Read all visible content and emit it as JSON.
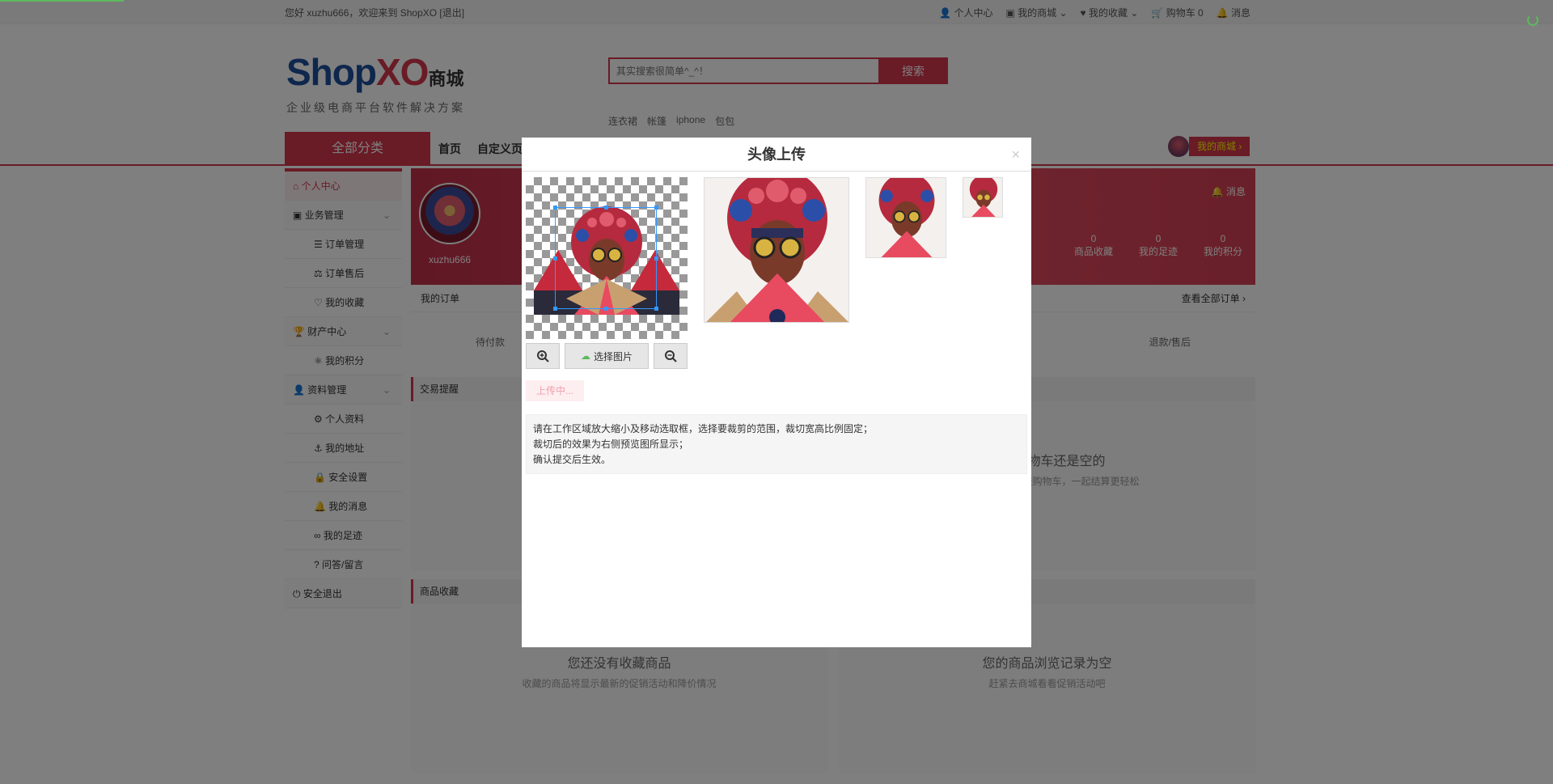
{
  "topbar": {
    "welcome_prefix": "您好 xuzhu666，欢迎来到 ShopXO",
    "logout": "[退出]",
    "nav": [
      "个人中心",
      "我的商城",
      "我的收藏",
      "购物车 0",
      "消息"
    ]
  },
  "logo": {
    "shop": "Shop",
    "xo": "XO",
    "mall": "商城",
    "slogan": "企业级电商平台软件解决方案"
  },
  "search": {
    "placeholder": "其实搜索很简单^_^！",
    "button": "搜索",
    "hotwords": [
      "连衣裙",
      "帐篷",
      "iphone",
      "包包"
    ]
  },
  "navbar": {
    "all_categories": "全部分类",
    "links": [
      "首页",
      "自定义页"
    ],
    "my_mall": "我的商城 ›"
  },
  "sidebar": {
    "items": [
      {
        "label": "个人中心",
        "type": "active"
      },
      {
        "label": "业务管理",
        "type": "group"
      },
      {
        "label": "订单管理",
        "type": "sub"
      },
      {
        "label": "订单售后",
        "type": "sub"
      },
      {
        "label": "我的收藏",
        "type": "sub"
      },
      {
        "label": "财产中心",
        "type": "group"
      },
      {
        "label": "我的积分",
        "type": "sub"
      },
      {
        "label": "资料管理",
        "type": "group"
      },
      {
        "label": "个人资料",
        "type": "sub"
      },
      {
        "label": "我的地址",
        "type": "sub"
      },
      {
        "label": "安全设置",
        "type": "sub"
      },
      {
        "label": "我的消息",
        "type": "sub"
      },
      {
        "label": "我的足迹",
        "type": "sub"
      },
      {
        "label": "问答/留言",
        "type": "sub"
      },
      {
        "label": "安全退出",
        "type": "group"
      }
    ]
  },
  "profile": {
    "username": "xuzhu666",
    "message": "消息",
    "stats": [
      {
        "value": "0",
        "label": "商品收藏"
      },
      {
        "value": "0",
        "label": "我的足迹"
      },
      {
        "value": "0",
        "label": "我的积分"
      }
    ]
  },
  "orders": {
    "title": "我的订单",
    "view_all": "查看全部订单 ›",
    "first": "待付款",
    "last": "退款/售后"
  },
  "sections": {
    "trade_alert": "交易提醒",
    "favorites": "商品收藏",
    "cart_empty": "您的购物车还是空的",
    "cart_empty_sub": "将想买的商品放进购物车，一起结算更轻松",
    "fav_empty": "您还没有收藏商品",
    "fav_empty_sub": "收藏的商品将显示最新的促销活动和降价情况",
    "history_empty": "您的商品浏览记录为空",
    "history_empty_sub": "赶紧去商城看看促销活动吧"
  },
  "modal": {
    "title": "头像上传",
    "close": "×",
    "zoom_in": "zoom-in",
    "choose": "选择图片",
    "zoom_out": "zoom-out",
    "upload": "上传中...",
    "tips": [
      "请在工作区域放大缩小及移动选取框，选择要裁剪的范围，裁切宽高比例固定；",
      "裁切后的效果为右侧预览图所显示；",
      "确认提交后生效。"
    ]
  },
  "colors": {
    "accent": "#d2364c",
    "brand_blue": "#1d4e9b",
    "progress": "#5eb95e"
  }
}
